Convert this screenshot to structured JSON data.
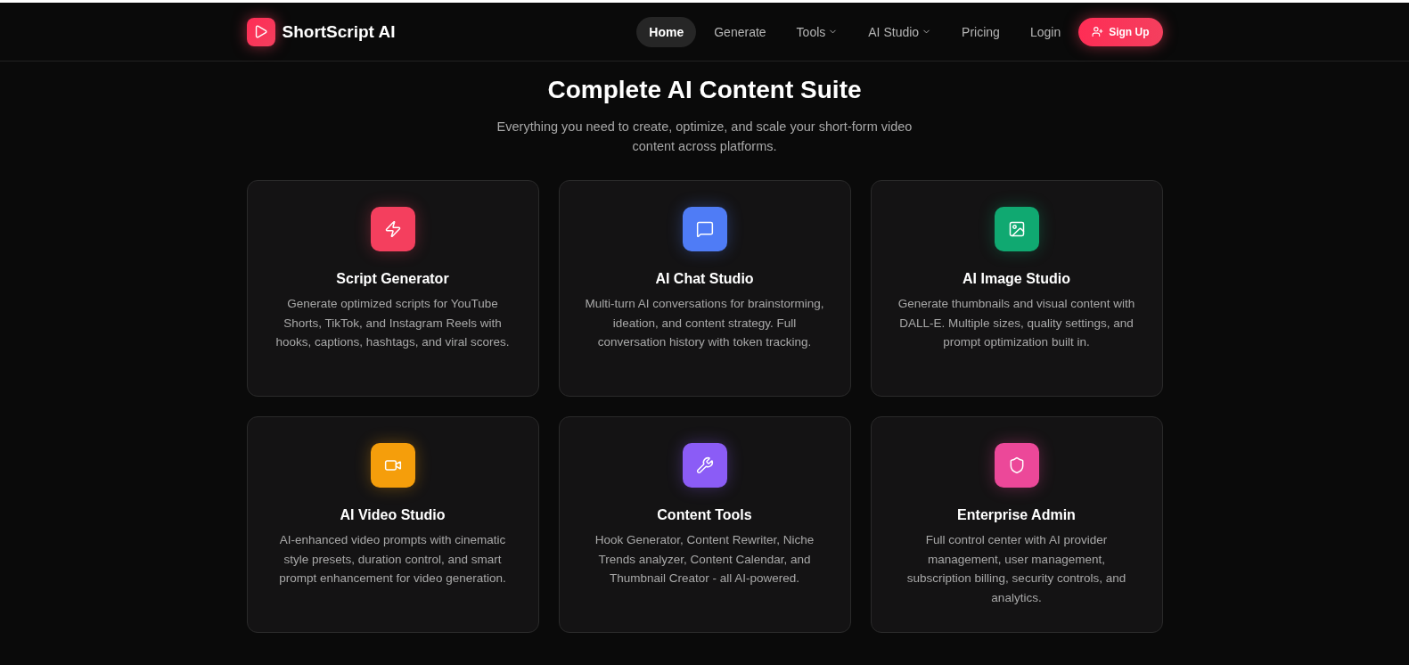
{
  "brand": {
    "name": "ShortScript AI"
  },
  "nav": [
    {
      "label": "Home",
      "kind": "link",
      "selected": true
    },
    {
      "label": "Generate",
      "kind": "link",
      "selected": false
    },
    {
      "label": "Tools",
      "kind": "dropdown",
      "selected": false
    },
    {
      "label": "AI Studio",
      "kind": "dropdown",
      "selected": false
    },
    {
      "label": "Pricing",
      "kind": "link",
      "selected": false
    },
    {
      "label": "Login",
      "kind": "link",
      "selected": false
    },
    {
      "label": "Sign Up",
      "kind": "cta",
      "selected": false
    }
  ],
  "hero": {
    "title": "Complete AI Content Suite",
    "subtitle": "Everything you need to create, optimize, and scale your short-form video content across platforms."
  },
  "features": [
    {
      "title": "Script Generator",
      "description": "Generate optimized scripts for YouTube Shorts, TikTok, and Instagram Reels with hooks, captions, hashtags, and viral scores.",
      "color": "#f43f5e"
    },
    {
      "title": "AI Chat Studio",
      "description": "Multi-turn AI conversations for brainstorming, ideation, and content strategy. Full conversation history with token tracking.",
      "color": "#4f7cf6"
    },
    {
      "title": "AI Image Studio",
      "description": "Generate thumbnails and visual content with DALL-E. Multiple sizes, quality settings, and prompt optimization built in.",
      "color": "#10a971"
    },
    {
      "title": "AI Video Studio",
      "description": "AI-enhanced video prompts with cinematic style presets, duration control, and smart prompt enhancement for video generation.",
      "color": "#f59e0b"
    },
    {
      "title": "Content Tools",
      "description": "Hook Generator, Content Rewriter, Niche Trends analyzer, Content Calendar, and Thumbnail Creator - all AI-powered.",
      "color": "#8b5cf6"
    },
    {
      "title": "Enterprise Admin",
      "description": "Full control center with AI provider management, user management, subscription billing, security controls, and analytics.",
      "color": "#ec4899"
    }
  ]
}
